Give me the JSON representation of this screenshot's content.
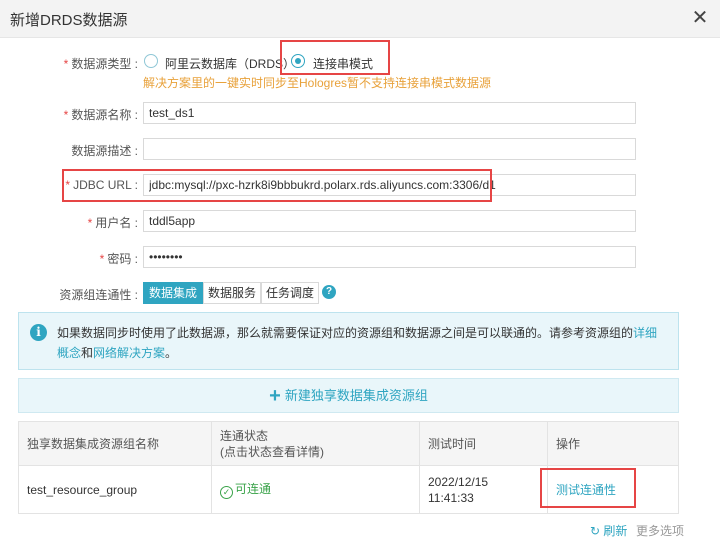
{
  "dialog": {
    "title": "新增DRDS数据源",
    "close_icon": "close-icon"
  },
  "form": {
    "type_label": "数据源类型 :",
    "type_options": [
      "阿里云数据库（DRDS）",
      "连接串模式"
    ],
    "type_selected": "连接串模式",
    "type_hint": "解决方案里的一键实时同步至Hologres暂不支持连接串模式数据源",
    "name_label": "数据源名称 :",
    "name_value": "test_ds1",
    "desc_label": "数据源描述 :",
    "desc_value": "",
    "jdbc_label": "JDBC URL :",
    "jdbc_value": "jdbc:mysql://pxc-hzrk8i9bbbukrd.polarx.rds.aliyuncs.com:3306/d1",
    "user_label": "用户名 :",
    "user_value": "tddl5app",
    "pwd_label": "密码 :",
    "pwd_value": "••••••••",
    "conn_label": "资源组连通性 :",
    "conn_tabs": [
      "数据集成",
      "数据服务",
      "任务调度"
    ],
    "conn_active": "数据集成"
  },
  "info": {
    "text_before": "如果数据同步时使用了此数据源，那么就需要保证对应的资源组和数据源之间是可以联通的。请参考资源组的",
    "link1": "详细概念",
    "text_mid": "和",
    "link2": "网络解决方案",
    "text_after": "。"
  },
  "new_group": {
    "label": "新建独享数据集成资源组"
  },
  "table": {
    "headers": [
      "独享数据集成资源组名称",
      "连通状态",
      "(点击状态查看详情)",
      "测试时间",
      "操作"
    ],
    "rows": [
      {
        "name": "test_resource_group",
        "status": "可连通",
        "time_date": "2022/12/15",
        "time_clock": "11:41:33",
        "action": "测试连通性"
      }
    ]
  },
  "footer": {
    "refresh": "刷新",
    "more": "更多选项"
  },
  "colors": {
    "accent": "#2fa5c1",
    "required": "#e64545",
    "hint": "#e8a13a",
    "success": "#3aa34a"
  }
}
